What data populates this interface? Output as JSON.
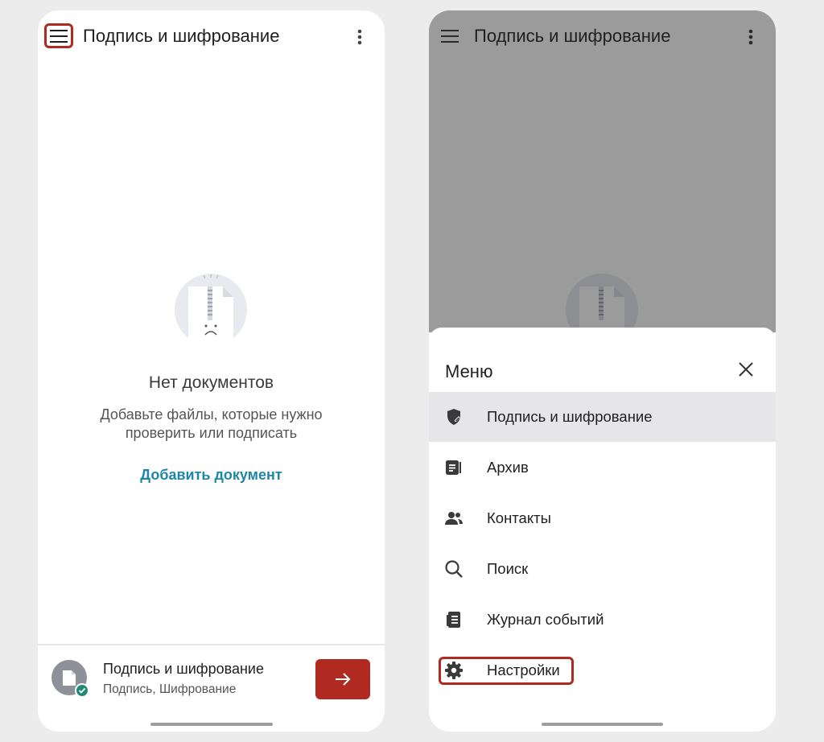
{
  "left_screen": {
    "title": "Подпись и шифрование",
    "empty_title": "Нет документов",
    "empty_text": "Добавьте файлы, которые нужно\nпроверить или подписать",
    "add_link": "Добавить документ",
    "bottom_card": {
      "title": "Подпись и шифрование",
      "subtitle": "Подпись, Шифрование"
    }
  },
  "right_screen": {
    "title": "Подпись и шифрование",
    "sheet_title": "Меню",
    "menu_items": [
      {
        "label": "Подпись и шифрование",
        "icon": "shield-pen-icon",
        "active": true
      },
      {
        "label": "Архив",
        "icon": "archive-icon",
        "active": false
      },
      {
        "label": "Контакты",
        "icon": "contacts-icon",
        "active": false
      },
      {
        "label": "Поиск",
        "icon": "search-icon",
        "active": false
      },
      {
        "label": "Журнал событий",
        "icon": "event-log-icon",
        "active": false
      },
      {
        "label": "Настройки",
        "icon": "gear-icon",
        "active": false,
        "highlighted": true
      }
    ]
  },
  "colors": {
    "accent_red": "#b02a22",
    "link_blue": "#1f86a8",
    "status_green": "#1e8a74",
    "overlay_gray": "#9b9b9b"
  }
}
